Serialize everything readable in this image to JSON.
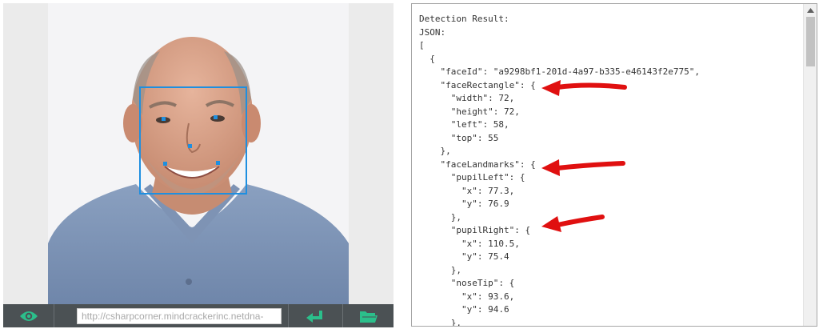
{
  "toolbar": {
    "url_value": "http://csharpcorner.mindcrackerinc.netdna-",
    "eye_icon": "eye-icon",
    "enter_icon": "enter-return-icon",
    "folder_icon": "open-folder-icon"
  },
  "detection": {
    "face_box_color": "#1e8fe0",
    "arrow_color": "#e01010",
    "lines": [
      "Detection Result:",
      "JSON:",
      "[",
      "  {",
      "    \"faceId\": \"a9298bf1-201d-4a97-b335-e46143f2e775\",",
      "    \"faceRectangle\": {",
      "      \"width\": 72,",
      "      \"height\": 72,",
      "      \"left\": 58,",
      "      \"top\": 55",
      "    },",
      "    \"faceLandmarks\": {",
      "      \"pupilLeft\": {",
      "        \"x\": 77.3,",
      "        \"y\": 76.9",
      "      },",
      "      \"pupilRight\": {",
      "        \"x\": 110.5,",
      "        \"y\": 75.4",
      "      },",
      "      \"noseTip\": {",
      "        \"x\": 93.6,",
      "        \"y\": 94.6",
      "      },"
    ]
  }
}
